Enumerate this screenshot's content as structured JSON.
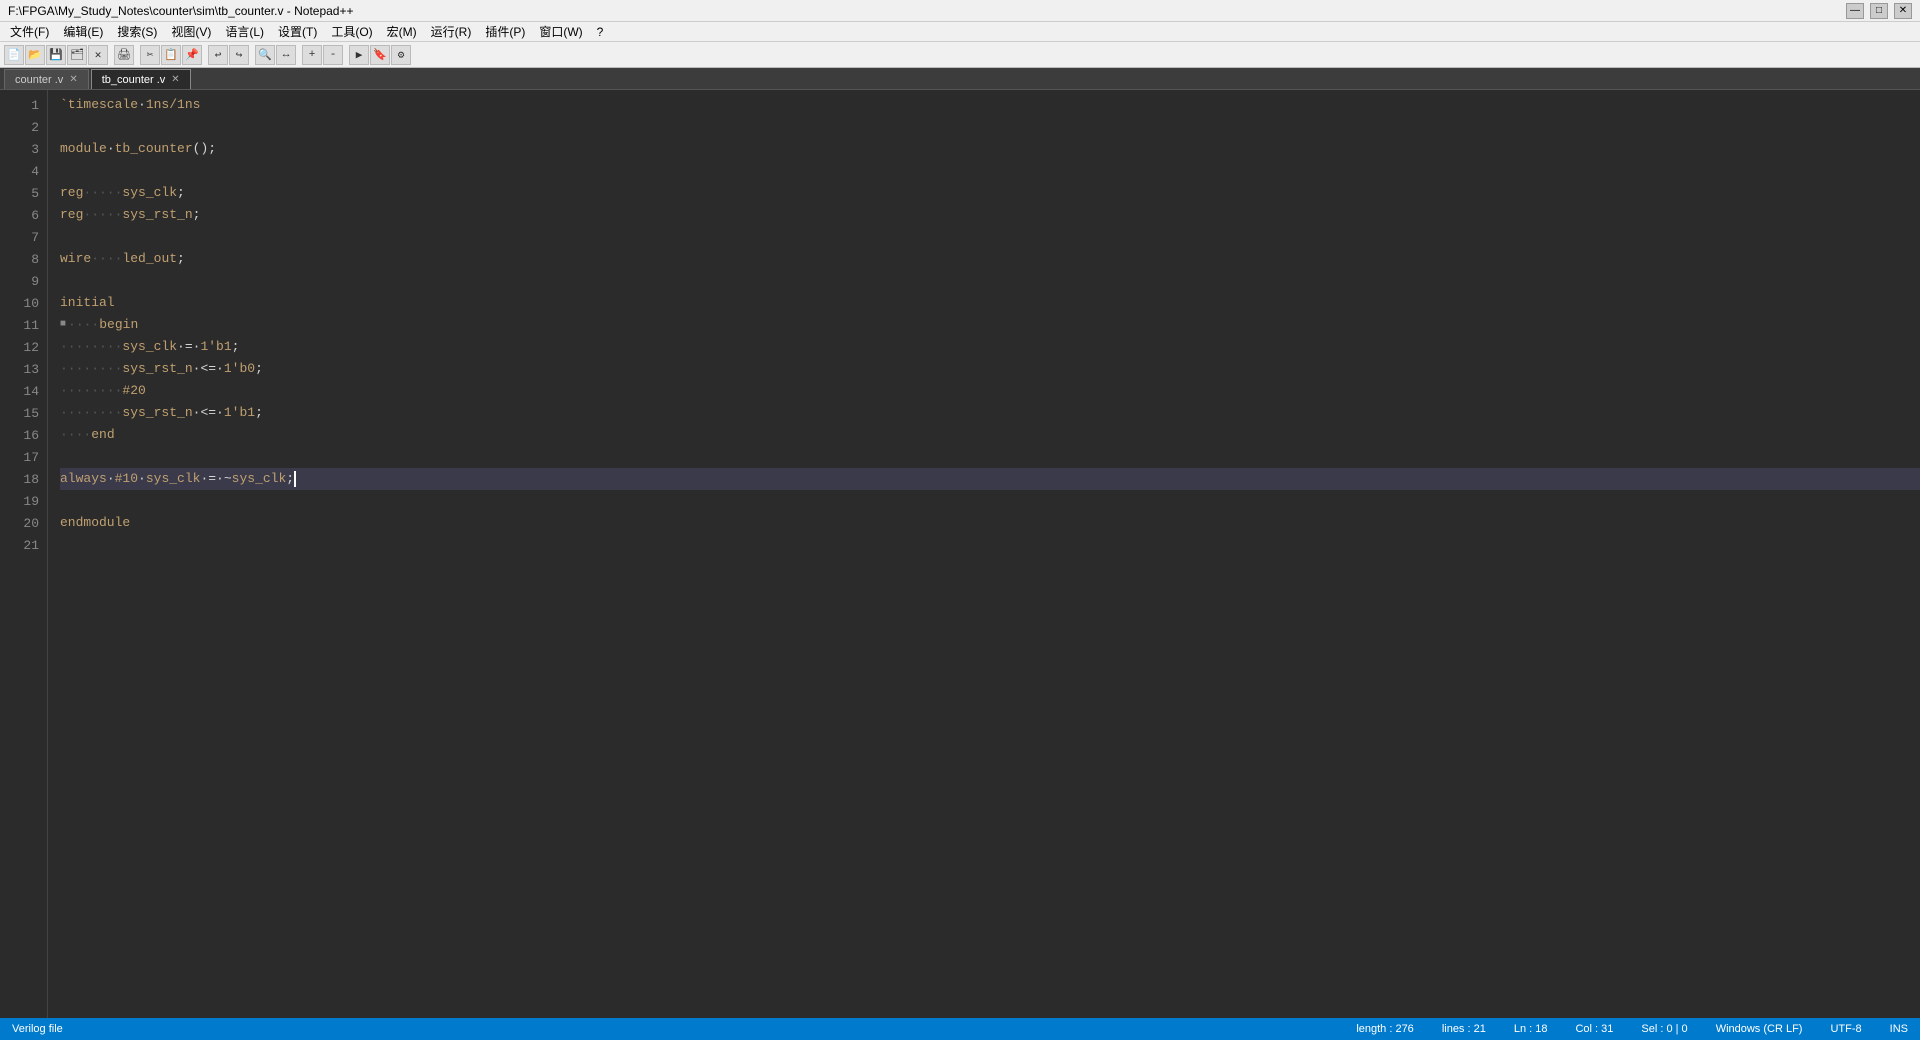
{
  "titlebar": {
    "title": "F:\\FPGA\\My_Study_Notes\\counter\\sim\\tb_counter.v - Notepad++",
    "min": "—",
    "max": "□",
    "close": "✕"
  },
  "menubar": {
    "items": [
      "文件(F)",
      "编辑(E)",
      "搜索(S)",
      "视图(V)",
      "语言(L)",
      "设置(T)",
      "工具(O)",
      "宏(M)",
      "运行(R)",
      "插件(P)",
      "窗口(W)",
      "?"
    ]
  },
  "tabs": [
    {
      "label": "counter .v",
      "active": false
    },
    {
      "label": "tb_counter .v",
      "active": true
    }
  ],
  "code": {
    "lines": [
      {
        "num": 1,
        "content": "`timescale 1ns/1ns",
        "active": false
      },
      {
        "num": 2,
        "content": "",
        "active": false
      },
      {
        "num": 3,
        "content": "module tb_counter();",
        "active": false
      },
      {
        "num": 4,
        "content": "",
        "active": false
      },
      {
        "num": 5,
        "content": "reg·····sys_clk;",
        "active": false
      },
      {
        "num": 6,
        "content": "reg·····sys_rst_n;",
        "active": false
      },
      {
        "num": 7,
        "content": "",
        "active": false
      },
      {
        "num": 8,
        "content": "wire····led_out;",
        "active": false
      },
      {
        "num": 9,
        "content": "",
        "active": false
      },
      {
        "num": 10,
        "content": "initial",
        "active": false
      },
      {
        "num": 11,
        "content": "·····begin",
        "active": false,
        "foldable": true
      },
      {
        "num": 12,
        "content": "·····    sys_clk = 1'b1;",
        "active": false
      },
      {
        "num": 13,
        "content": "·····    sys_rst_n <= 1'b0;",
        "active": false
      },
      {
        "num": 14,
        "content": "·····    #20",
        "active": false
      },
      {
        "num": 15,
        "content": "·····    sys_rst_n <= 1'b1;",
        "active": false
      },
      {
        "num": 16,
        "content": "····end",
        "active": false
      },
      {
        "num": 17,
        "content": "",
        "active": false
      },
      {
        "num": 18,
        "content": "always #10 sys_clk = ~sys_clk;",
        "active": true
      },
      {
        "num": 19,
        "content": "",
        "active": false
      },
      {
        "num": 20,
        "content": "endmodule",
        "active": false
      },
      {
        "num": 21,
        "content": "",
        "active": false
      }
    ]
  },
  "statusbar": {
    "file_type": "Verilog file",
    "length": "length : 276",
    "lines": "lines : 21",
    "ln": "Ln : 18",
    "col": "Col : 31",
    "sel": "Sel : 0 | 0",
    "encoding": "UTF-8",
    "eol": "Windows (CR LF)",
    "ins": "INS"
  }
}
